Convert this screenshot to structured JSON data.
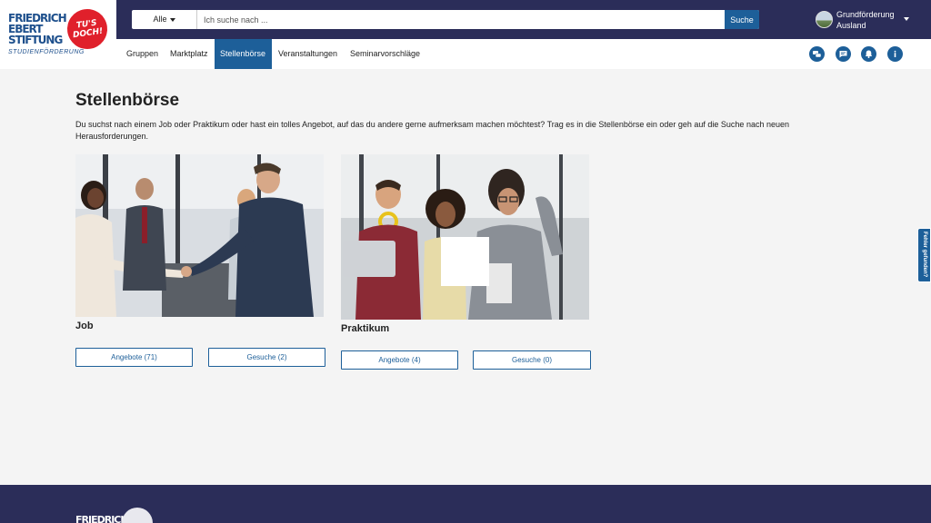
{
  "logo": {
    "lines": [
      "FRIEDRICH",
      "EBERT",
      "STIFTUNG"
    ],
    "subtitle": "STUDIENFÖRDERUNG",
    "badge_line1": "TU'S",
    "badge_line2": "DOCH!"
  },
  "search": {
    "category": "Alle",
    "placeholder": "Ich suche nach ...",
    "button_label": "Suche"
  },
  "user": {
    "name_line1": "Grundförderung",
    "name_line2": "Ausland"
  },
  "nav": {
    "items": [
      {
        "label": "Gruppen"
      },
      {
        "label": "Marktplatz"
      },
      {
        "label": "Stellenbörse"
      },
      {
        "label": "Veranstaltungen"
      },
      {
        "label": "Seminarvorschläge"
      }
    ],
    "active": "Stellenbörse"
  },
  "header_icons": [
    "chat-bubbles-icon",
    "message-icon",
    "bell-icon",
    "info-icon"
  ],
  "colors": {
    "header_dark": "#2b2d59",
    "accent_blue": "#1d5f99",
    "brand_red": "#e0202b",
    "page_bg": "#f4f4f4"
  },
  "main": {
    "title": "Stellenbörse",
    "intro": "Du suchst nach einem Job oder Praktikum oder hast ein tolles Angebot, auf das du andere gerne aufmerksam machen möchtest? Trag es in die Stellenbörse ein oder geh auf die Suche nach neuen Herausforderungen.",
    "cards": [
      {
        "title": "Job",
        "offers_label": "Angebote (71)",
        "requests_label": "Gesuche (2)"
      },
      {
        "title": "Praktikum",
        "offers_label": "Angebote (4)",
        "requests_label": "Gesuche (0)"
      }
    ]
  },
  "feedback_tab": {
    "label": "Fehler gefunden?"
  },
  "footer": {
    "logo_text": "FRIEDRICH"
  }
}
